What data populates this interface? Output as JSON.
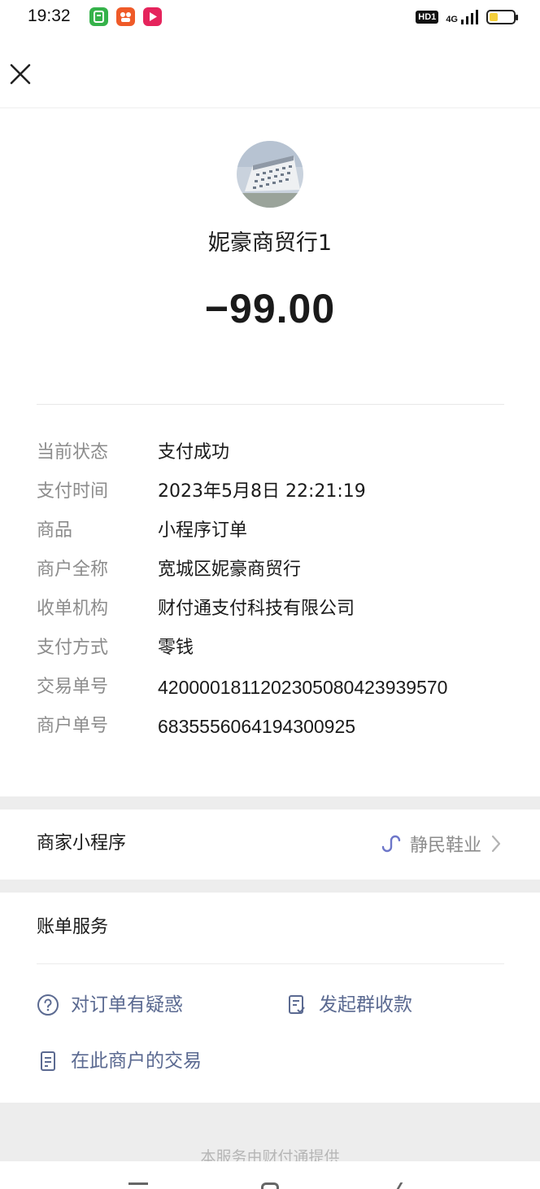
{
  "status_bar": {
    "time": "19:32",
    "apps": [
      {
        "icon": "wechat-app-icon",
        "color": "#35b24a"
      },
      {
        "icon": "taobao-app-icon",
        "color": "#ef5a28"
      },
      {
        "icon": "video-app-icon",
        "color": "#e5245c"
      }
    ],
    "hd_badge": "HD1",
    "network": "4G",
    "battery_level": 0.35,
    "battery_color": "#f4cf3b"
  },
  "header": {
    "close_icon": "close-icon"
  },
  "merchant": {
    "name": "妮豪商贸行1",
    "amount": "−99.00"
  },
  "details": [
    {
      "label": "当前状态",
      "value": "支付成功"
    },
    {
      "label": "支付时间",
      "value": "2023年5月8日 22:21:19"
    },
    {
      "label": "商品",
      "value": "小程序订单"
    },
    {
      "label": "商户全称",
      "value": "宽城区妮豪商贸行"
    },
    {
      "label": "收单机构",
      "value": "财付通支付科技有限公司"
    },
    {
      "label": "支付方式",
      "value": "零钱"
    },
    {
      "label": "交易单号",
      "value": "4200001811202305080423939570"
    },
    {
      "label": "商户单号",
      "value": "6835556064194300925"
    }
  ],
  "mini_program": {
    "label": "商家小程序",
    "value": "静民鞋业",
    "icon": "mini-program-link-icon",
    "chevron": "chevron-right-icon"
  },
  "bill_services": {
    "title": "账单服务",
    "items": [
      {
        "label": "对订单有疑惑",
        "icon": "question-circle-icon"
      },
      {
        "label": "发起群收款",
        "icon": "group-collect-icon"
      },
      {
        "label": "在此商户的交易",
        "icon": "document-list-icon"
      }
    ]
  },
  "footer": {
    "text": "本服务由财付通提供"
  },
  "colors": {
    "link_blue": "#5b6a91",
    "label_gray": "#8c8c8c",
    "band_gray": "#ededed"
  }
}
